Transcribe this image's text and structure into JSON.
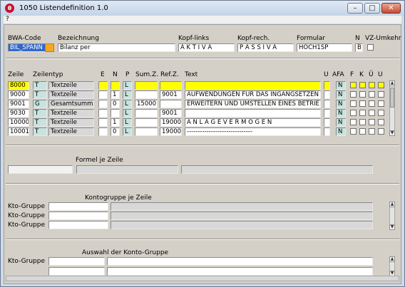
{
  "window": {
    "title": "1050 Listendefinition 1.0",
    "icon_letter": "θ",
    "minimize": "–",
    "maximize": "□",
    "close": "✕"
  },
  "menu": {
    "help": "?"
  },
  "header": {
    "bwa_label": "BWA-Code",
    "bwa_value": "BIL_SPANN",
    "bez_label": "Bezeichnung",
    "bez_value": "Bilanz per",
    "kopf_links_label": "Kopf-links",
    "kopf_links_value": "A K T I V A",
    "kopf_rech_label": "Kopf-rech.",
    "kopf_rech_value": "P A S S I V A",
    "formular_label": "Formular",
    "formular_value": "HOCH1SP",
    "n_label": "N",
    "n_value": "B",
    "vz_label": "VZ-Umkehr"
  },
  "table": {
    "columns": {
      "zeile": "Zeile",
      "zeilentyp": "Zeilentyp",
      "e": "E",
      "n": "N",
      "p": "P",
      "sumz": "Sum.Z.",
      "refz": "Ref.Z.",
      "text": "Text",
      "u": "U",
      "afa": "AFA",
      "f": "F",
      "k": "K",
      "ue": "Ü",
      "u2": "U"
    },
    "rows": [
      {
        "zeile": "8000",
        "typ": "T",
        "typtext": "Textzeile",
        "e": "",
        "n": "",
        "p": "L",
        "sumz": "",
        "refz": "",
        "text": "",
        "afa": "N",
        "highlight": true
      },
      {
        "zeile": "9000",
        "typ": "T",
        "typtext": "Textzeile",
        "e": "",
        "n": "1",
        "p": "L",
        "sumz": "",
        "refz": "9001",
        "text": "AUFWENDUNGEN FÜR DAS INGANGSETZEN",
        "afa": "N",
        "highlight": false
      },
      {
        "zeile": "9001",
        "typ": "G",
        "typtext": "Gesamtsumme",
        "e": "",
        "n": "0",
        "p": "L",
        "sumz": "15000",
        "refz": "",
        "text": "ERWEITERN UND UMSTELLEN EINES BETRIE",
        "afa": "N",
        "highlight": false
      },
      {
        "zeile": "9030",
        "typ": "T",
        "typtext": "Textzeile",
        "e": "",
        "n": "",
        "p": "L",
        "sumz": "",
        "refz": "9001",
        "text": "",
        "afa": "N",
        "highlight": false
      },
      {
        "zeile": "10000",
        "typ": "T",
        "typtext": "Textzeile",
        "e": "",
        "n": "1",
        "p": "L",
        "sumz": "",
        "refz": "19000",
        "text": "A N L A G E V E R M Ö G E N",
        "afa": "N",
        "highlight": false
      },
      {
        "zeile": "10001",
        "typ": "T",
        "typtext": "Textzeile",
        "e": "",
        "n": "0",
        "p": "L",
        "sumz": "",
        "refz": "19000",
        "text": "------------------------------",
        "afa": "N",
        "highlight": false
      }
    ]
  },
  "formel": {
    "heading": "Formel je Zeile"
  },
  "kontogruppe": {
    "heading": "Kontogruppe je Zeile",
    "label": "Kto-Gruppe"
  },
  "auswahl": {
    "heading": "Auswahl der Konto-Gruppe",
    "label": "Kto-Gruppe"
  }
}
